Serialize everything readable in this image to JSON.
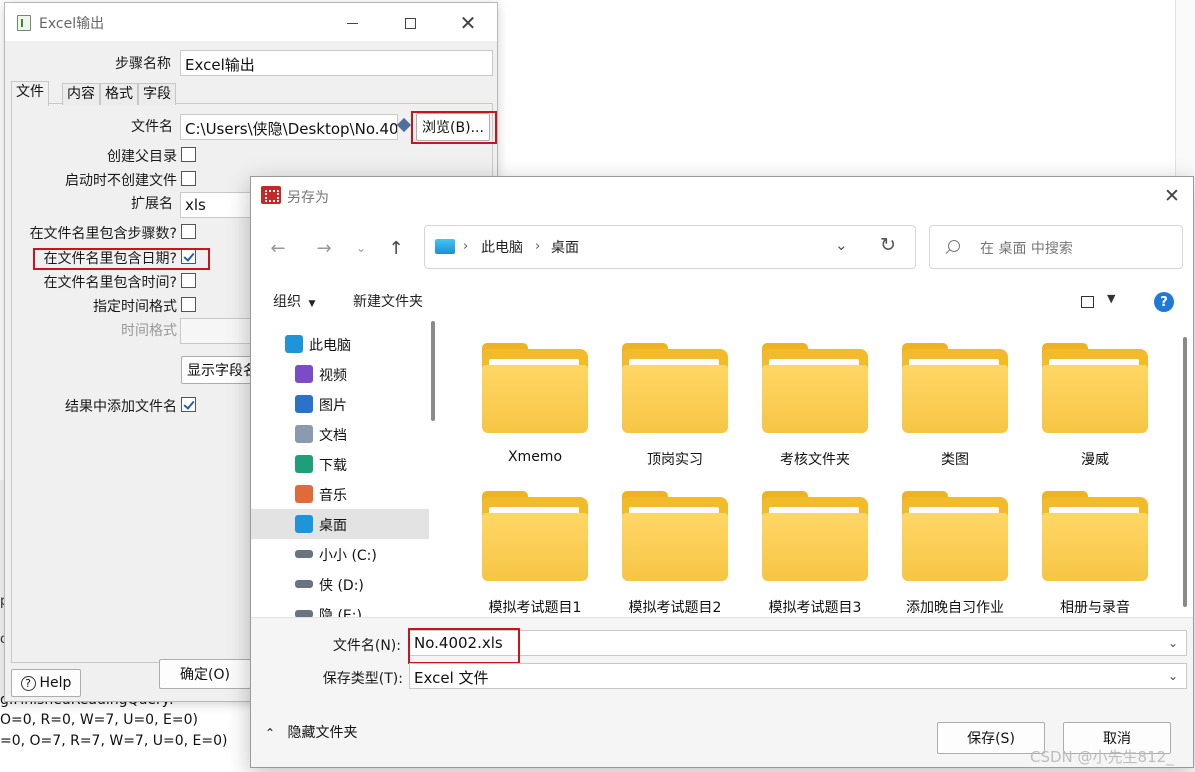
{
  "background": {
    "log_lines": [
      "g.FinishedReadingQuery:",
      "O=0, R=0, W=7, U=0, E=0)",
      "=0, O=7, R=7, W=7, U=0, E=0)"
    ],
    "edge_chars": [
      "p",
      "o"
    ]
  },
  "excel_dialog": {
    "title": "Excel输出",
    "step_name_label": "步骤名称",
    "step_name_value": "Excel输出",
    "tabs": [
      "文件",
      "内容",
      "格式",
      "字段"
    ],
    "filename_label": "文件名",
    "filename_value": "C:\\Users\\侠隐\\Desktop\\No.40",
    "browse_button": "浏览(B)...",
    "create_parent_dir_label": "创建父目录",
    "no_create_on_start_label": "启动时不创建文件",
    "extension_label": "扩展名",
    "extension_value": "xls",
    "include_stepnr_label": "在文件名里包含步骤数?",
    "include_date_label": "在文件名里包含日期?",
    "include_date_checked": true,
    "include_time_label": "在文件名里包含时间?",
    "specify_time_format_label": "指定时间格式",
    "time_format_label": "时间格式",
    "show_fields_button": "显示字段名",
    "add_filename_result_label": "结果中添加文件名",
    "add_filename_result_checked": true,
    "help_button": "Help",
    "ok_button": "确定(O)"
  },
  "save_as": {
    "title": "另存为",
    "breadcrumbs": [
      "此电脑",
      "桌面"
    ],
    "search_placeholder": "在 桌面 中搜索",
    "toolbar": {
      "organize": "组织",
      "new_folder": "新建文件夹"
    },
    "nav_items": [
      {
        "label": "此电脑",
        "icon": "computer-icon",
        "color": "#1e95d8"
      },
      {
        "label": "视频",
        "icon": "video-icon",
        "color": "#7c4cc6"
      },
      {
        "label": "图片",
        "icon": "picture-icon",
        "color": "#2a73c8"
      },
      {
        "label": "文档",
        "icon": "document-icon",
        "color": "#8a9bb0"
      },
      {
        "label": "下载",
        "icon": "download-icon",
        "color": "#1f9e7a"
      },
      {
        "label": "音乐",
        "icon": "music-icon",
        "color": "#e06a3a"
      },
      {
        "label": "桌面",
        "icon": "desktop-icon",
        "color": "#1e95d8",
        "selected": true
      },
      {
        "label": "小小 (C:)",
        "icon": "drive-icon",
        "color": "#6a7480"
      },
      {
        "label": "侠 (D:)",
        "icon": "drive-icon",
        "color": "#6a7480"
      },
      {
        "label": "隐 (E:)",
        "icon": "drive-icon",
        "color": "#6a7480"
      }
    ],
    "folders": [
      "Xmemo",
      "顶岗实习",
      "考核文件夹",
      "类图",
      "漫威",
      "模拟考试题目1",
      "模拟考试题目2",
      "模拟考试题目3",
      "添加晚自习作业",
      "相册与录音"
    ],
    "filename_label": "文件名(N):",
    "filename_value": "No.4002.xls",
    "filetype_label": "保存类型(T):",
    "filetype_value": "Excel 文件",
    "hide_folders": "隐藏文件夹",
    "save_button": "保存(S)",
    "cancel_button": "取消"
  },
  "watermark": "CSDN @小先生812_"
}
